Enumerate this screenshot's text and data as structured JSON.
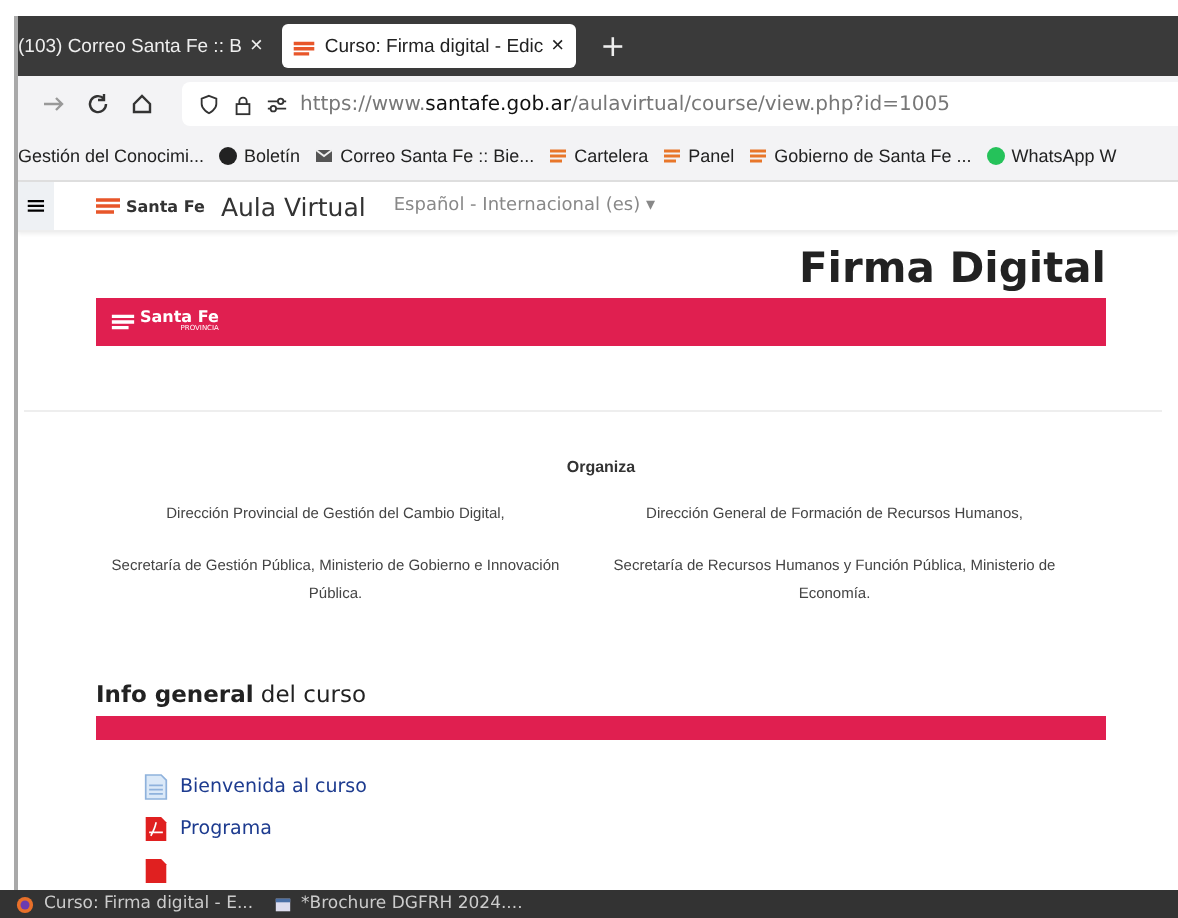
{
  "tabs": [
    {
      "label": "(103) Correo Santa Fe :: B",
      "selected": false,
      "close": "×"
    },
    {
      "label": "Curso: Firma digital - Edic",
      "selected": true,
      "close": "×"
    }
  ],
  "new_tab": "+",
  "address": {
    "url": "https://www.**santafe.gob.ar**/aulavirtual/course/view.php?id=1005"
  },
  "bookmarks": [
    {
      "kind": "plain",
      "label": "Gestión del Conocimi..."
    },
    {
      "kind": "dark",
      "label": "Boletín"
    },
    {
      "kind": "mail",
      "label": "Correo Santa Fe :: Bie..."
    },
    {
      "kind": "santafe",
      "label": "Cartelera"
    },
    {
      "kind": "santafe",
      "label": "Panel"
    },
    {
      "kind": "santafe",
      "label": "Gobierno de Santa Fe ..."
    },
    {
      "kind": "whatsapp",
      "label": "WhatsApp W"
    }
  ],
  "site_header": {
    "menu": "≡",
    "logo": "Santa Fe",
    "title": "Aula Virtual",
    "language": "Español - Internacional (es)",
    "language_caret": "▾"
  },
  "course": {
    "title": "Firma Digital",
    "banner_logo": "Santa Fe",
    "banner_sub": "PROVINCIA"
  },
  "organiza": {
    "heading": "Organiza",
    "columns": [
      [
        "Dirección Provincial de Gestión del Cambio Digital,",
        "Secretaría de Gestión Pública, Ministerio de Gobierno e Innovación Pública."
      ],
      [
        "Dirección General de Formación de Recursos Humanos,",
        "Secretaría de Recursos Humanos y Función Pública, Ministerio de Economía."
      ]
    ]
  },
  "info": {
    "heading": "**Info general** del curso"
  },
  "items": [
    {
      "kind": "page",
      "label": "Bienvenida al curso"
    },
    {
      "kind": "pdf",
      "label": "Programa"
    }
  ],
  "taskbar": [
    {
      "kind": "browser",
      "label": "Curso: Firma digital - E..."
    },
    {
      "kind": "document",
      "label": "*Brochure DGFRH 2024...."
    }
  ]
}
